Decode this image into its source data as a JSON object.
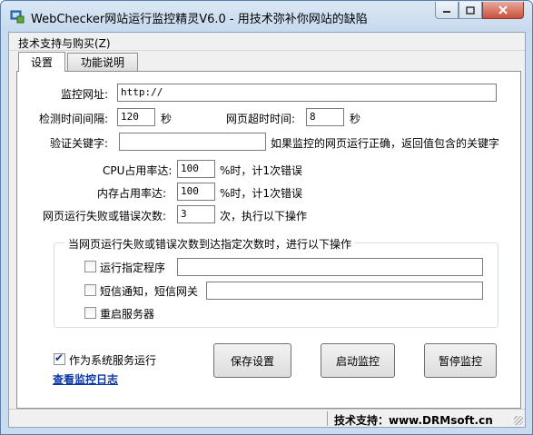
{
  "window": {
    "title": "WebChecker网站运行监控精灵V6.0 - 用技术弥补你网站的缺陷",
    "icon": "app-icon"
  },
  "menu": {
    "item": "技术支持与购买(Z)"
  },
  "tabs": [
    {
      "label": "设置",
      "active": true
    },
    {
      "label": "功能说明",
      "active": false
    }
  ],
  "form": {
    "url_label": "监控网址:",
    "url_value": "http://",
    "interval_label": "检测时间间隔:",
    "interval_value": "120",
    "interval_unit": "秒",
    "timeout_label": "网页超时时间:",
    "timeout_value": "8",
    "timeout_unit": "秒",
    "keyword_label": "验证关键字:",
    "keyword_value": "",
    "keyword_hint": "如果监控的网页运行正确，返回值包含的关键字",
    "cpu_label": "CPU占用率达:",
    "cpu_value": "100",
    "cpu_hint": "%时，计1次错误",
    "mem_label": "内存占用率达:",
    "mem_value": "100",
    "mem_hint": "%时，计1次错误",
    "fail_label": "网页运行失败或错误次数:",
    "fail_value": "3",
    "fail_hint": "次，执行以下操作"
  },
  "group": {
    "title": "当网页运行失败或错误次数到达指定次数时，进行以下操作",
    "run_program_label": "运行指定程序",
    "run_program_value": "",
    "sms_label": "短信通知，短信网关",
    "sms_value": "",
    "restart_label": "重启服务器"
  },
  "service": {
    "label": "作为系统服务运行",
    "checked": true
  },
  "log_link": "查看监控日志",
  "buttons": {
    "save": "保存设置",
    "start": "启动监控",
    "pause": "暂停监控"
  },
  "status": {
    "text": "技术支持：www.DRMsoft.cn"
  },
  "colors": {
    "titlebar": "#c6d9ee",
    "link": "#0b36a8",
    "close": "#c9503d"
  }
}
